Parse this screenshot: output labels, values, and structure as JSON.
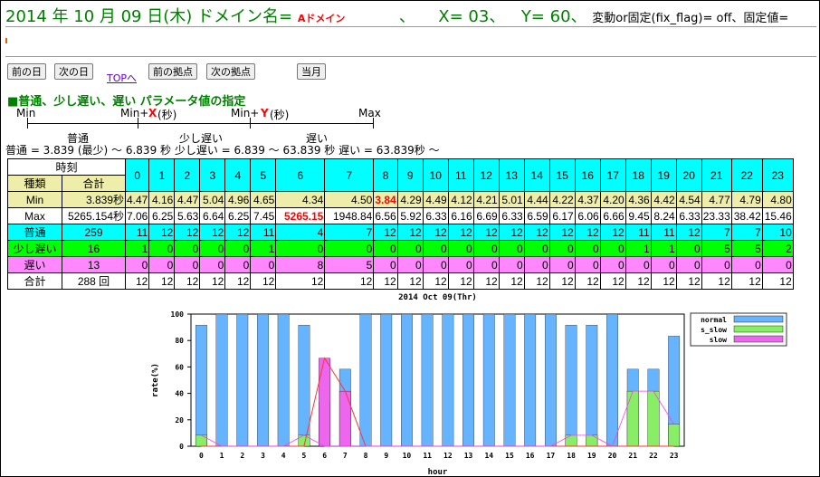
{
  "header": {
    "date": "2014 年 10 月 09 日(木)",
    "domain_label": "ドメイン名=",
    "domain_value": "Aドメイン",
    "sep1": "、",
    "x_label": "X= 03、",
    "y_label": "Y= 60、",
    "flag_text": "変動or固定(fix_flag)= off、固定値="
  },
  "nav": {
    "prev_day": "前の日",
    "next_day": "次の日",
    "top": "TOPへ",
    "prev_site": "前の拠点",
    "next_site": "次の拠点",
    "this_month": "当月"
  },
  "section_title": "■普通、少し遅い、遅い パラメータ値の指定",
  "scale": {
    "min": "Min",
    "min_x": "Min+",
    "x": "X",
    "x_unit": "(秒)",
    "min_y": "Min+",
    "y": "Y",
    "y_unit": "(秒)",
    "max": "Max",
    "normal": "普通",
    "little_slow": "少し遅い",
    "slow": "遅い"
  },
  "summary": "普通 = 3.839 (最少)  ～  6.839 秒        少し遅い = 6.839  ～  63.839 秒        遅い = 63.839秒  ～",
  "table": {
    "time_header": "時刻",
    "kind_header": "種類",
    "total_header": "合計",
    "hours": [
      "0",
      "1",
      "2",
      "3",
      "4",
      "5",
      "6",
      "7",
      "8",
      "9",
      "10",
      "11",
      "12",
      "13",
      "14",
      "15",
      "16",
      "17",
      "18",
      "19",
      "20",
      "21",
      "22",
      "23"
    ],
    "rows": [
      {
        "label": "Min",
        "total": "3.839秒",
        "values": [
          "4.47",
          "4.16",
          "4.47",
          "5.04",
          "4.96",
          "4.65",
          "4.34",
          "4.50",
          "3.84",
          "4.29",
          "4.49",
          "4.12",
          "4.21",
          "5.01",
          "4.44",
          "4.22",
          "4.37",
          "4.20",
          "4.36",
          "4.42",
          "4.54",
          "4.77",
          "4.79",
          "4.80"
        ],
        "cls": "tan"
      },
      {
        "label": "Max",
        "total": "5265.154秒",
        "values": [
          "7.06",
          "6.25",
          "5.63",
          "6.64",
          "6.25",
          "7.45",
          "5265.15",
          "1948.84",
          "6.56",
          "5.92",
          "6.33",
          "6.16",
          "6.69",
          "6.33",
          "6.59",
          "6.17",
          "6.06",
          "6.66",
          "9.45",
          "8.24",
          "6.33",
          "23.33",
          "38.42",
          "15.46"
        ],
        "cls": "white"
      },
      {
        "label": "普通",
        "total": "259",
        "values": [
          "11",
          "12",
          "12",
          "12",
          "12",
          "11",
          "4",
          "7",
          "12",
          "12",
          "12",
          "12",
          "12",
          "12",
          "12",
          "12",
          "12",
          "12",
          "11",
          "11",
          "12",
          "7",
          "7",
          "10"
        ],
        "cls": "cyan"
      },
      {
        "label": "少し遅い",
        "total": "16",
        "values": [
          "1",
          "0",
          "0",
          "0",
          "0",
          "1",
          "0",
          "0",
          "0",
          "0",
          "0",
          "0",
          "0",
          "0",
          "0",
          "0",
          "0",
          "0",
          "1",
          "1",
          "0",
          "5",
          "5",
          "2"
        ],
        "cls": "green"
      },
      {
        "label": "遅い",
        "total": "13",
        "values": [
          "0",
          "0",
          "0",
          "0",
          "0",
          "0",
          "8",
          "5",
          "0",
          "0",
          "0",
          "0",
          "0",
          "0",
          "0",
          "0",
          "0",
          "0",
          "0",
          "0",
          "0",
          "0",
          "0",
          "0"
        ],
        "cls": "pink"
      },
      {
        "label": "合計",
        "total": "288 回",
        "values": [
          "12",
          "12",
          "12",
          "12",
          "12",
          "12",
          "12",
          "12",
          "12",
          "12",
          "12",
          "12",
          "12",
          "12",
          "12",
          "12",
          "12",
          "12",
          "12",
          "12",
          "12",
          "12",
          "12",
          "12"
        ],
        "cls": "white"
      }
    ]
  },
  "colors": {
    "normal": "#66b3ff",
    "s_slow": "#88ee66",
    "slow": "#ee66ee",
    "line": "#ff3333"
  },
  "chart_data": {
    "type": "bar",
    "title": "2014 Oct 09(Thr)",
    "xlabel": "hour",
    "ylabel": "rate(%)",
    "ylim": [
      0,
      100
    ],
    "yticks": [
      0,
      20,
      40,
      60,
      80,
      100
    ],
    "categories": [
      "0",
      "1",
      "2",
      "3",
      "4",
      "5",
      "6",
      "7",
      "8",
      "9",
      "10",
      "11",
      "12",
      "13",
      "14",
      "15",
      "16",
      "17",
      "18",
      "19",
      "20",
      "21",
      "22",
      "23"
    ],
    "legend_position": "right",
    "series": [
      {
        "name": "normal",
        "values": [
          91.7,
          100,
          100,
          100,
          100,
          91.7,
          33.3,
          58.3,
          100,
          100,
          100,
          100,
          100,
          100,
          100,
          100,
          100,
          100,
          91.7,
          91.7,
          100,
          58.3,
          58.3,
          83.3
        ]
      },
      {
        "name": "s_slow",
        "values": [
          8.3,
          0,
          0,
          0,
          0,
          8.3,
          0,
          0,
          0,
          0,
          0,
          0,
          0,
          0,
          0,
          0,
          0,
          0,
          8.3,
          8.3,
          0,
          41.7,
          41.7,
          16.7
        ]
      },
      {
        "name": "slow",
        "values": [
          0,
          0,
          0,
          0,
          0,
          0,
          66.7,
          41.7,
          0,
          0,
          0,
          0,
          0,
          0,
          0,
          0,
          0,
          0,
          0,
          0,
          0,
          0,
          0,
          0
        ]
      }
    ]
  }
}
